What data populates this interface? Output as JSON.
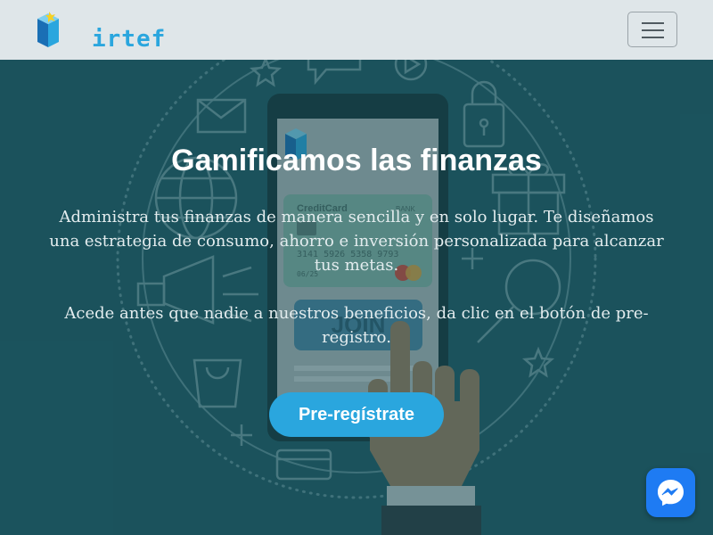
{
  "navbar": {
    "brand": "irtef",
    "toggler_icon": "hamburger-icon"
  },
  "hero": {
    "title": "Gamificamos las finanzas",
    "paragraph_1": "Administra tus finanzas de manera sencilla y en solo lugar. Te diseñamos una estrategia de consumo, ahorro e inversión personalizada para alcanzar tus metas.",
    "paragraph_2": "Acede antes que nadie a nuestros beneficios, da clic en el botón de pre-registro.",
    "cta_label": "Pre-regístrate"
  },
  "background": {
    "card_brand": "CreditCard",
    "card_bank": "BANK",
    "card_number": "3141 5926 5358 9793",
    "card_expiry": "06/25",
    "phone_button": "JOIN"
  },
  "chat_widget": {
    "icon": "messenger-icon"
  },
  "colors": {
    "hero_bg": "#1f5963",
    "navbar_bg": "#dfe6e9",
    "accent": "#2aa6de",
    "messenger": "#1e7bf3"
  }
}
